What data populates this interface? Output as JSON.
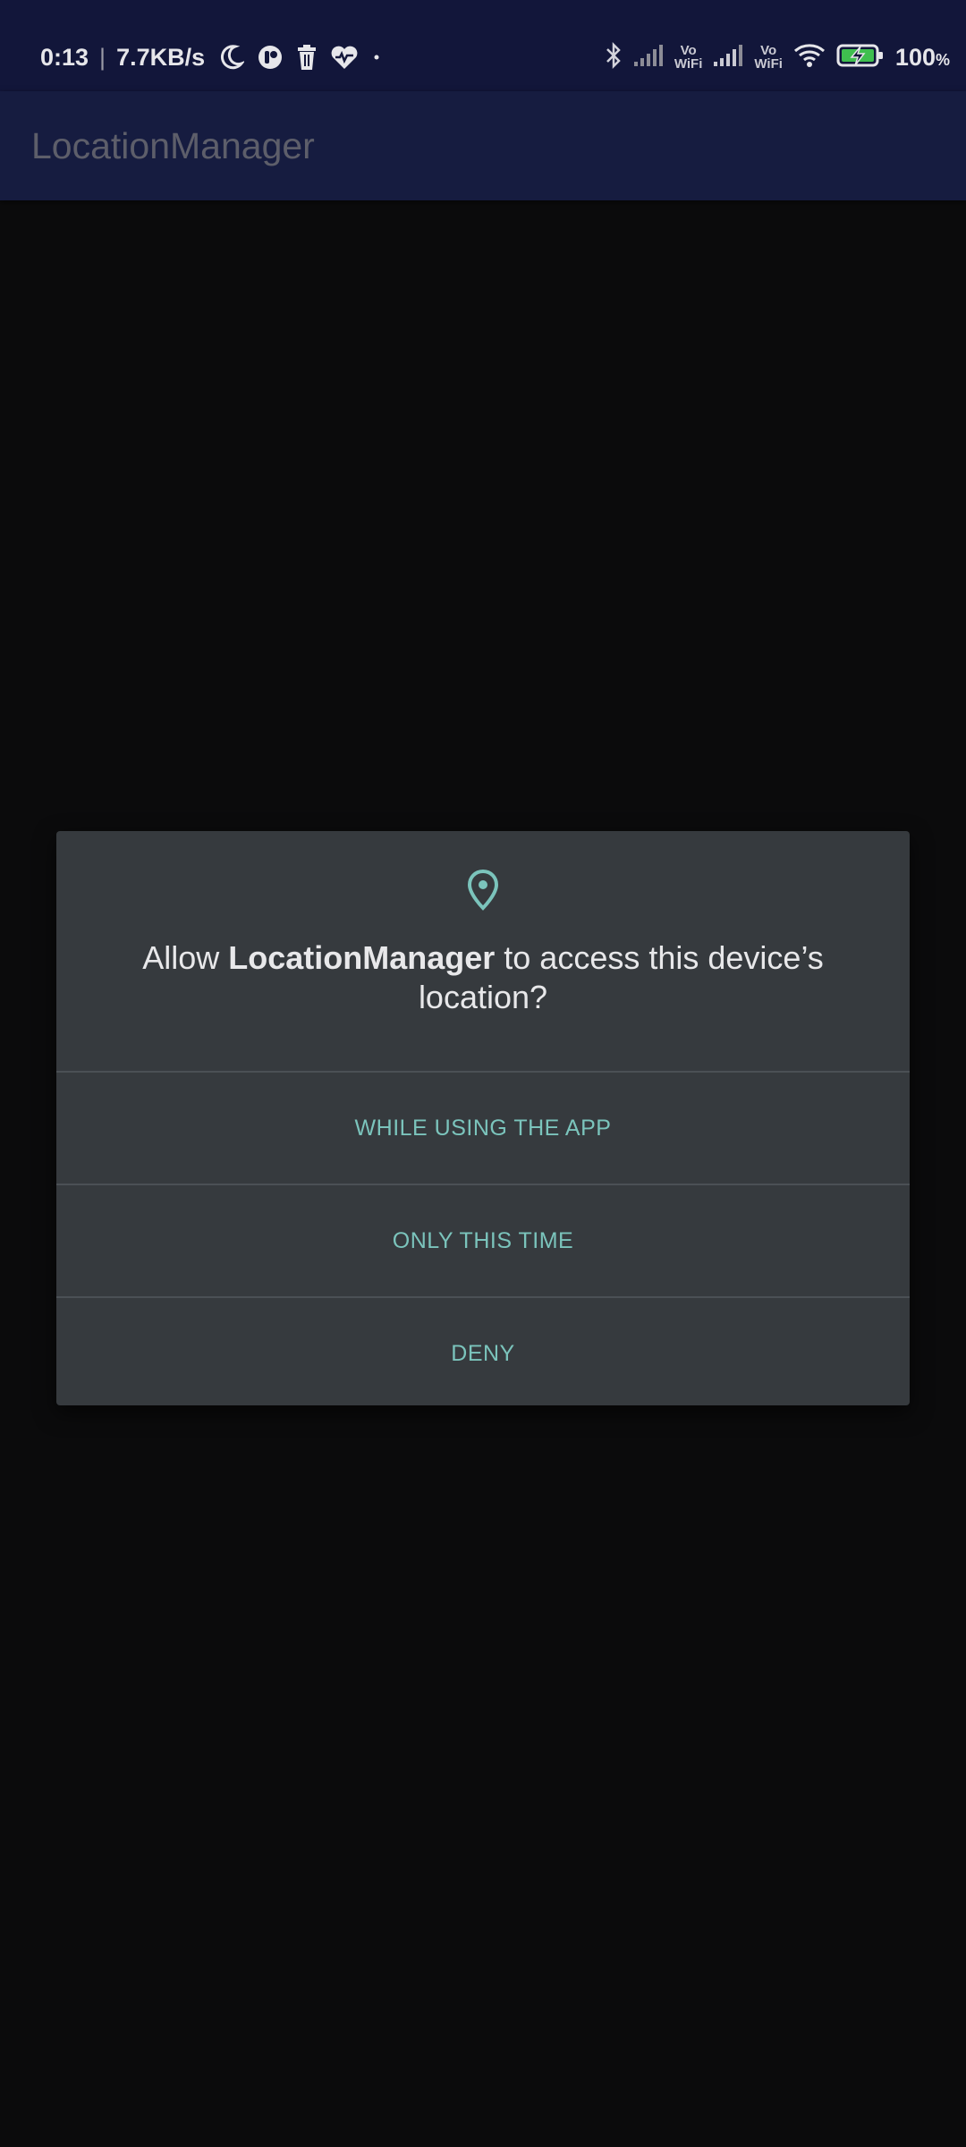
{
  "status_bar": {
    "time": "0:13",
    "separator": "|",
    "network_speed": "7.7KB/s",
    "icons": [
      "moon-icon",
      "app-notification-icon",
      "trash-icon",
      "heart-icon",
      "dot-icon"
    ],
    "right_icons": [
      "bluetooth-icon",
      "signal-icon",
      "vowifi-icon",
      "signal-icon",
      "vowifi-icon",
      "wifi-icon",
      "battery-charging-icon"
    ],
    "vowifi_top": "Vo",
    "vowifi_bottom": "WiFi",
    "battery_value": "100",
    "battery_unit": "%"
  },
  "app_bar": {
    "title": "LocationManager"
  },
  "dialog": {
    "icon": "location-pin-icon",
    "message_prefix": "Allow ",
    "app_name": "LocationManager",
    "message_suffix": " to access this device’s location?",
    "options": [
      "WHILE USING THE APP",
      "ONLY THIS TIME",
      "DENY"
    ]
  },
  "colors": {
    "status_bar_bg": "#12163a",
    "app_bar_bg": "#161c40",
    "screen_bg": "#0b0b0c",
    "dialog_bg": "#363a3e",
    "accent": "#7bc4bc",
    "divider": "#4b5055"
  }
}
